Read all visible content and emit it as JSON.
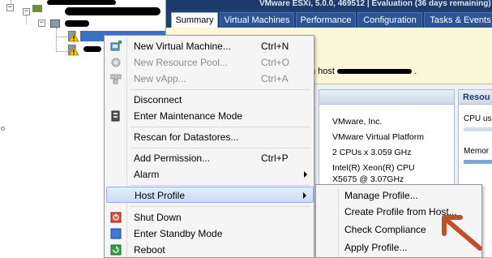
{
  "title_bar": {
    "text": "VMware ESXi, 5.0.0, 469512 | Evaluation (36 days remaining)"
  },
  "tabs": [
    {
      "label": "Summary",
      "active": true
    },
    {
      "label": "Virtual Machines",
      "active": false
    },
    {
      "label": "Performance",
      "active": false
    },
    {
      "label": "Configuration",
      "active": false
    },
    {
      "label": "Tasks & Events",
      "active": false
    }
  ],
  "host_notice": {
    "prefix": "n host"
  },
  "general": {
    "rows": [
      "VMware, Inc.",
      "VMware Virtual Platform",
      "2 CPUs x 3.059 GHz",
      "Intel(R) Xeon(R) CPU",
      "X5675  @ 3.07GHz"
    ]
  },
  "resources": {
    "header": "Resou",
    "cpu_label": "CPU us",
    "memory_label": "Memor"
  },
  "context_menu": {
    "items": [
      {
        "label": "New Virtual Machine...",
        "shortcut": "Ctrl+N",
        "enabled": true,
        "icon": "new-vm-icon"
      },
      {
        "label": "New Resource Pool...",
        "shortcut": "Ctrl+O",
        "enabled": false,
        "icon": "resource-pool-icon"
      },
      {
        "label": "New vApp...",
        "shortcut": "Ctrl+A",
        "enabled": false,
        "icon": "vapp-icon"
      },
      {
        "label": "Disconnect",
        "shortcut": "",
        "enabled": true,
        "icon": ""
      },
      {
        "label": "Enter Maintenance Mode",
        "shortcut": "",
        "enabled": true,
        "icon": "maintenance-icon"
      },
      {
        "label": "Rescan for Datastores...",
        "shortcut": "",
        "enabled": true,
        "icon": ""
      },
      {
        "label": "Add Permission...",
        "shortcut": "Ctrl+P",
        "enabled": true,
        "icon": ""
      },
      {
        "label": "Alarm",
        "shortcut": "",
        "enabled": true,
        "icon": "",
        "submenu": true
      },
      {
        "label": "Host Profile",
        "shortcut": "",
        "enabled": true,
        "icon": "",
        "submenu": true,
        "highlighted": true
      },
      {
        "label": "Shut Down",
        "shortcut": "",
        "enabled": true,
        "icon": "shutdown-icon"
      },
      {
        "label": "Enter Standby Mode",
        "shortcut": "",
        "enabled": true,
        "icon": "standby-icon"
      },
      {
        "label": "Reboot",
        "shortcut": "",
        "enabled": true,
        "icon": "reboot-icon"
      }
    ]
  },
  "host_profile_submenu": {
    "items": [
      {
        "label": "Manage Profile..."
      },
      {
        "label": "Create Profile from Host..."
      },
      {
        "label": "Check Compliance"
      },
      {
        "label": "Apply Profile..."
      }
    ]
  },
  "colors": {
    "tab_bg": "#2d5496",
    "title_bar": "#1c3a6b",
    "menu_highlight": "#c9dcf5",
    "annotation_arrow": "#c0502a",
    "warning": "#f2c400"
  }
}
